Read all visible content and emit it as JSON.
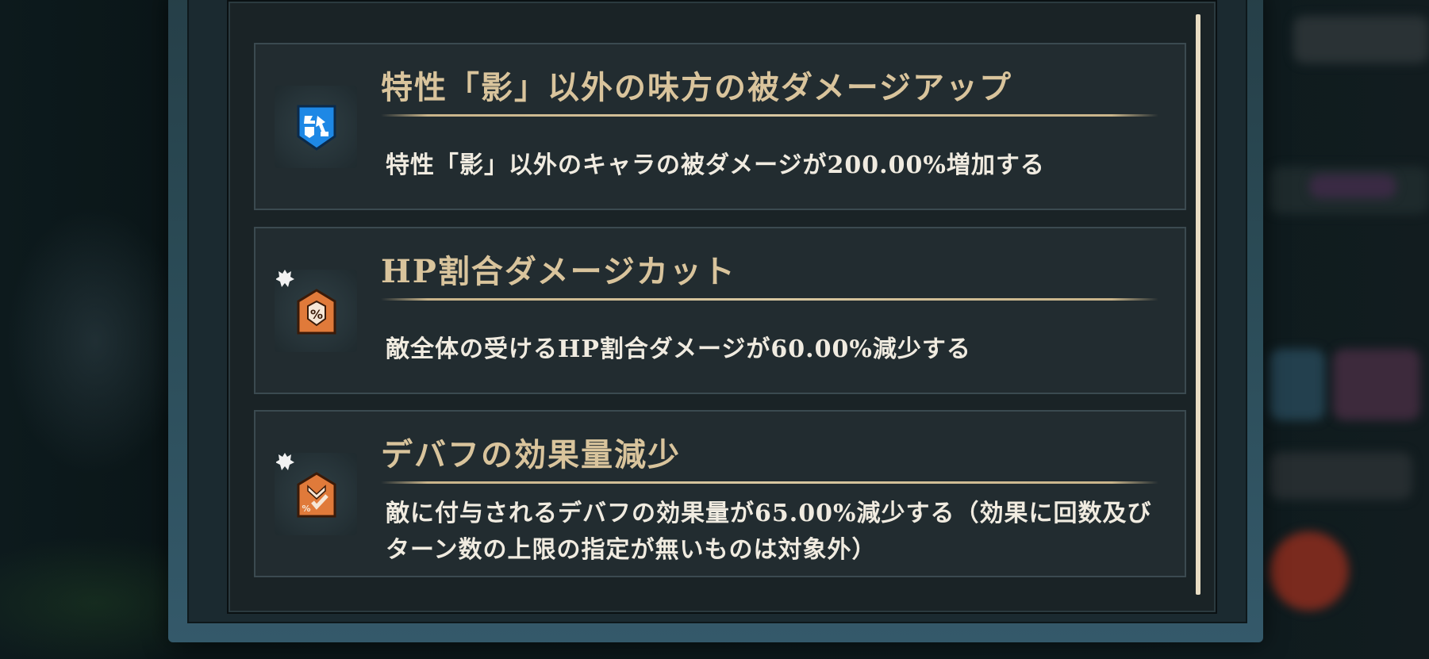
{
  "effects": [
    {
      "title": "特性「影」以外の味方の被ダメージアップ",
      "description": "特性「影」以外のキャラの被ダメージが200.00%増加する",
      "icon": "shadow-damage-up-icon",
      "icon_color": "#1e88e5"
    },
    {
      "title": "HP割合ダメージカット",
      "description": "敵全体の受けるHP割合ダメージが60.00%減少する",
      "icon": "percent-shield-icon",
      "icon_color": "#e07a3a"
    },
    {
      "title": "デバフの効果量減少",
      "description": "敵に付与されるデバフの効果量が65.00%減少する（効果に回数及びターン数の上限の指定が無いものは対象外）",
      "icon": "debuff-reduce-icon",
      "icon_color": "#e07a3a"
    }
  ],
  "colors": {
    "title": "#d9c49c",
    "description": "#f0ebe0",
    "card_bg": "#222c30",
    "frame": "#2a4a55"
  }
}
